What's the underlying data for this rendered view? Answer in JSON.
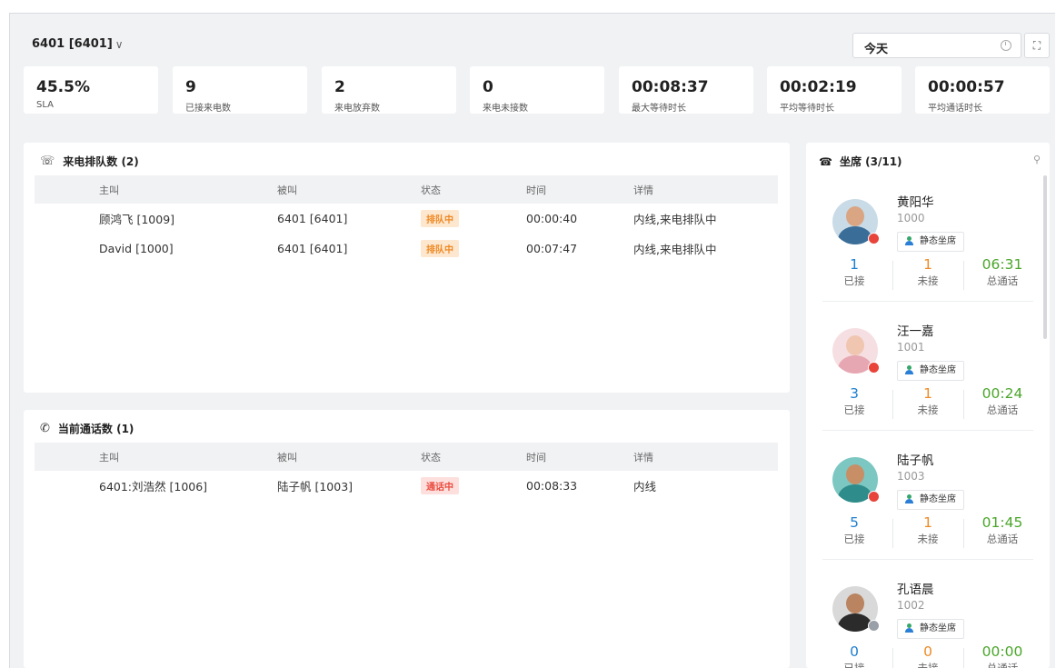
{
  "header": {
    "queue_selector": "6401 [6401]",
    "date_value": "今天"
  },
  "stats": [
    {
      "value": "45.5%",
      "label": "SLA"
    },
    {
      "value": "9",
      "label": "已接来电数"
    },
    {
      "value": "2",
      "label": "来电放弃数"
    },
    {
      "value": "0",
      "label": "来电未接数"
    },
    {
      "value": "00:08:37",
      "label": "最大等待时长"
    },
    {
      "value": "00:02:19",
      "label": "平均等待时长"
    },
    {
      "value": "00:00:57",
      "label": "平均通话时长"
    }
  ],
  "queue_panel": {
    "title": "来电排队数 (2)",
    "columns": [
      "主叫",
      "被叫",
      "状态",
      "时间",
      "详情"
    ],
    "rows": [
      {
        "caller": "顾鸿飞 [1009]",
        "callee": "6401 [6401]",
        "status": "排队中",
        "time": "00:00:40",
        "detail": "内线,来电排队中"
      },
      {
        "caller": "David [1000]",
        "callee": "6401 [6401]",
        "status": "排队中",
        "time": "00:07:47",
        "detail": "内线,来电排队中"
      }
    ]
  },
  "calls_panel": {
    "title": "当前通话数 (1)",
    "columns": [
      "主叫",
      "被叫",
      "状态",
      "时间",
      "详情"
    ],
    "rows": [
      {
        "caller": "6401:刘浩然 [1006]",
        "callee": "陆子帆 [1003]",
        "status": "通话中",
        "time": "00:08:33",
        "detail": "内线"
      }
    ]
  },
  "agents_panel": {
    "title": "坐席 (3/11)",
    "agents": [
      {
        "name": "黄阳华",
        "ext": "1000",
        "type": "静态坐席",
        "answered": "1",
        "answered_label": "已接",
        "missed": "1",
        "missed_label": "未接",
        "total": "06:31",
        "total_label": "总通话",
        "status_color": "#e8443a"
      },
      {
        "name": "汪一嘉",
        "ext": "1001",
        "type": "静态坐席",
        "answered": "3",
        "answered_label": "已接",
        "missed": "1",
        "missed_label": "未接",
        "total": "00:24",
        "total_label": "总通话",
        "status_color": "#e8443a"
      },
      {
        "name": "陆子帆",
        "ext": "1003",
        "type": "静态坐席",
        "answered": "5",
        "answered_label": "已接",
        "missed": "1",
        "missed_label": "未接",
        "total": "01:45",
        "total_label": "总通话",
        "status_color": "#e8443a"
      },
      {
        "name": "孔语晨",
        "ext": "1002",
        "type": "静态坐席",
        "answered": "0",
        "answered_label": "已接",
        "missed": "0",
        "missed_label": "未接",
        "total": "00:00",
        "total_label": "总通话",
        "status_color": "#9aa0a8"
      }
    ]
  },
  "colors": {
    "queue_tag": "#ef8a26",
    "talk_tag": "#ea4b3f",
    "answered": "#1f7fd0",
    "missed": "#ef8a26",
    "total": "#4aa62a"
  }
}
